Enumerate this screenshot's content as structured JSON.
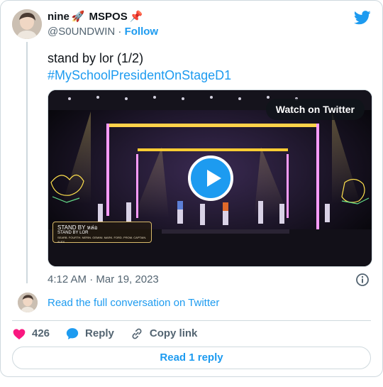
{
  "user": {
    "display_name": "nine",
    "name_suffix": "MSPOS",
    "emoji_rocket": "🚀",
    "emoji_pin": "📌",
    "handle": "@S0UNDWIN",
    "separator": "·",
    "follow_label": "Follow"
  },
  "tweet": {
    "text": "stand by lor (1/2)",
    "hashtag": "#MySchoolPresidentOnStageD1",
    "timestamp": "4:12 AM · Mar 19, 2023"
  },
  "media": {
    "watch_label": "Watch on Twitter",
    "caption_title": "STAND BY หล่อ",
    "caption_sub": "STAND BY LOR",
    "caption_credits": "SEARB. FOURTH. NERIN. GEMINI. MARK. FORD. PROM. CAPTAIN. ALEX"
  },
  "conversation_link": "Read the full conversation on Twitter",
  "actions": {
    "like_count": "426",
    "reply_label": "Reply",
    "copy_label": "Copy link"
  },
  "read_reply_label": "Read 1 reply",
  "colors": {
    "accent": "#1d9bf0",
    "like": "#f91880",
    "muted": "#536471"
  }
}
